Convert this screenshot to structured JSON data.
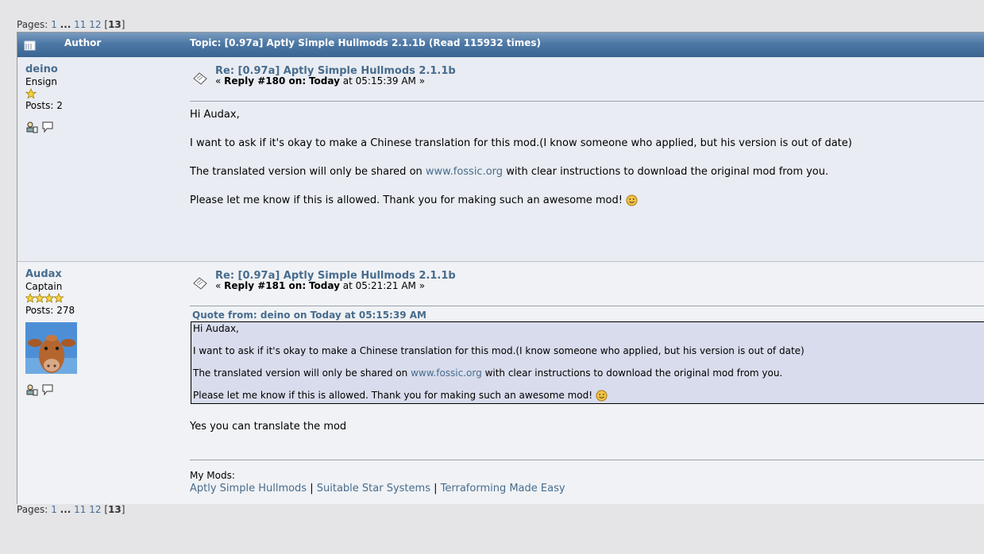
{
  "pagination": {
    "label": "Pages:",
    "p1": "1",
    "ellipsis": "...",
    "p11": "11",
    "p12": "12",
    "current": "13"
  },
  "header": {
    "author_col": "Author",
    "topic_col": "Topic: [0.97a] Aptly Simple Hullmods 2.1.1b  (Read 115932 times)"
  },
  "posts": [
    {
      "username": "deino",
      "rank": "Ensign",
      "posts_label": "Posts: 2",
      "subject": "Re: [0.97a] Aptly Simple Hullmods 2.1.1b",
      "reply_prefix": "«",
      "reply_num": "Reply #180 on:",
      "reply_day": "Today",
      "reply_time": "at 05:15:39 AM »",
      "line1": "Hi Audax,",
      "line2": "I want to ask if it's okay to make a Chinese translation for this mod.(I know someone who applied, but his version is out of date)",
      "line3_pre": "The translated version will only be shared on",
      "line3_link": "www.fossic.org",
      "line3_post": "with clear instructions to download the original mod from you.",
      "line4": "Please let me know if this is allowed. Thank you for making such an awesome mod!"
    },
    {
      "username": "Audax",
      "rank": "Captain",
      "posts_label": "Posts: 278",
      "subject": "Re: [0.97a] Aptly Simple Hullmods 2.1.1b",
      "reply_prefix": "«",
      "reply_num": "Reply #181 on:",
      "reply_day": "Today",
      "reply_time": "at 05:21:21 AM »",
      "quote_header": "Quote from: deino on Today at 05:15:39 AM",
      "reply_text": "Yes you can translate the mod",
      "sig_label": "My Mods:",
      "sig_mod1": "Aptly Simple Hullmods",
      "sig_sep": "|",
      "sig_mod2": "Suitable Star Systems",
      "sig_mod3": "Terraforming Made Easy"
    }
  ],
  "colors": {
    "link": "#476c8e",
    "header_bg": "#4d78a5",
    "quote_bg": "#d8dcec"
  }
}
